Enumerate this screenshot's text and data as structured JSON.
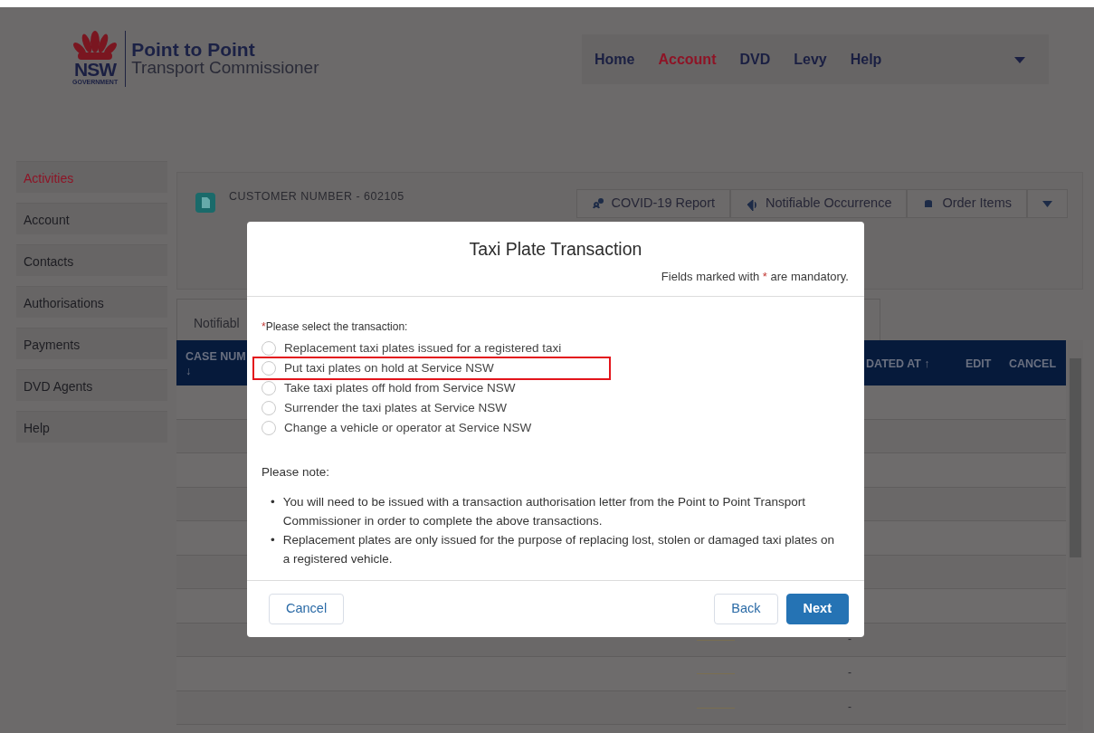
{
  "header": {
    "brand_mark": "NSW",
    "brand_sub": "GOVERNMENT",
    "title": "Point to Point",
    "subtitle": "Transport Commissioner"
  },
  "nav": [
    {
      "label": "Home",
      "selected": false
    },
    {
      "label": "Account",
      "selected": true
    },
    {
      "label": "DVD",
      "selected": false
    },
    {
      "label": "Levy",
      "selected": false
    },
    {
      "label": "Help",
      "selected": false
    }
  ],
  "sidebar": [
    {
      "label": "Activities",
      "selected": true
    },
    {
      "label": "Account",
      "selected": false
    },
    {
      "label": "Contacts",
      "selected": false
    },
    {
      "label": "Authorisations",
      "selected": false
    },
    {
      "label": "Payments",
      "selected": false
    },
    {
      "label": "DVD Agents",
      "selected": false
    },
    {
      "label": "Help",
      "selected": false
    }
  ],
  "record": {
    "title": "CUSTOMER NUMBER - 602105",
    "actions": [
      "COVID-19 Report",
      "Notifiable Occurrence",
      "Order Items"
    ]
  },
  "tabs": [
    {
      "label": "Notifiabl",
      "selected": true
    }
  ],
  "table": {
    "columns": [
      "CASE NUM\n↓",
      "DATED AT ↑",
      "EDIT",
      "CANCEL"
    ],
    "rows": [
      {
        "dash": ""
      },
      {
        "dash": ""
      },
      {
        "dash": ""
      },
      {
        "dash": ""
      },
      {
        "dash": ""
      },
      {
        "dash": ""
      },
      {
        "dash": ""
      },
      {
        "dash": "-"
      },
      {
        "dash": "-"
      },
      {
        "dash": "-"
      }
    ]
  },
  "dialog": {
    "title": "Taxi Plate Transaction",
    "mandatory_note": "Fields marked with * are mandatory.",
    "question": "Please select the transaction:",
    "question_required_mark": "*",
    "options": [
      {
        "label": "Replacement taxi plates issued for a registered taxi",
        "selected": false,
        "highlighted": false
      },
      {
        "label": "Put taxi plates on hold at Service NSW",
        "selected": false,
        "highlighted": true
      },
      {
        "label": "Take taxi plates off hold from Service NSW",
        "selected": false,
        "highlighted": false
      },
      {
        "label": "Surrender the taxi plates at Service NSW",
        "selected": false,
        "highlighted": false
      },
      {
        "label": "Change a vehicle or operator at Service NSW",
        "selected": false,
        "highlighted": false
      }
    ],
    "note_title": "Please note:",
    "notes": [
      {
        "bullet": "•",
        "text": "You will need to be issued with a transaction authorisation letter from the Point to Point Transport Commissioner in order to complete the above transactions."
      },
      {
        "bullet": "•",
        "text": "Replacement plates are only issued for the purpose of replacing lost, stolen or damaged taxi plates on a registered vehicle."
      }
    ],
    "buttons": [
      {
        "label": "Cancel",
        "kind": "secondary"
      },
      {
        "label": "Back",
        "kind": "secondary"
      },
      {
        "label": "Next",
        "kind": "primary"
      }
    ]
  }
}
